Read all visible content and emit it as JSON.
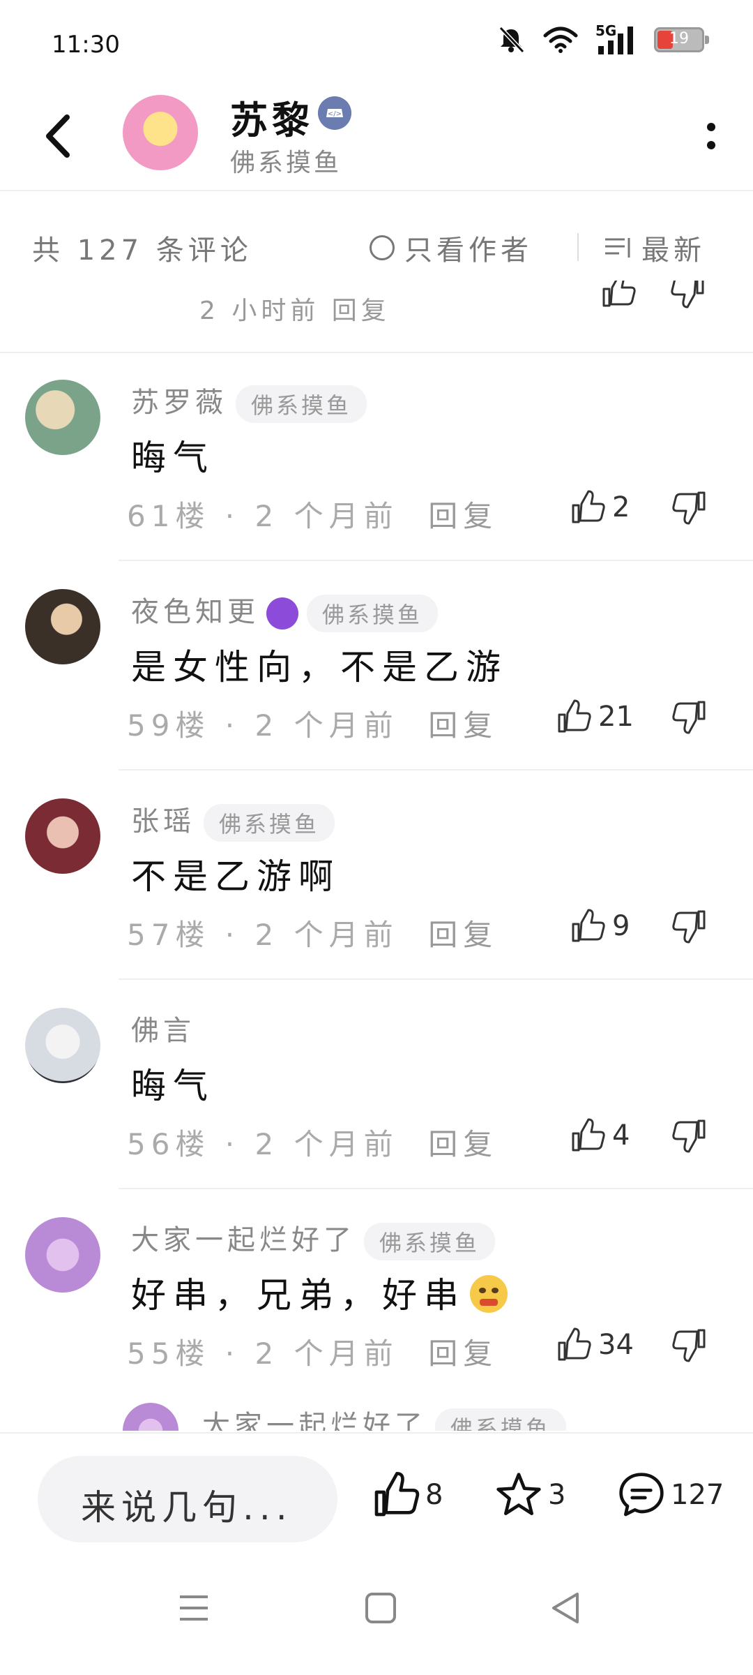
{
  "status_bar": {
    "time": "11:30",
    "network": "5G",
    "battery": "19"
  },
  "header": {
    "name": "苏黎",
    "subtitle": "佛系摸鱼"
  },
  "filter": {
    "count_text": "共 127 条评论",
    "author_only_label": "只看作者",
    "sort_label": "最新"
  },
  "partial_prev": {
    "meta": "2 小时前 回复"
  },
  "comments": [
    {
      "username": "苏罗薇",
      "tag": "佛系摸鱼",
      "content": "晦气",
      "floor": "61楼",
      "time": "2 个月前",
      "reply": "回复",
      "likes": "2",
      "avatar_color": "#7aa38a"
    },
    {
      "username": "夜色知更",
      "tag": "佛系摸鱼",
      "content": "是女性向，不是乙游",
      "floor": "59楼",
      "time": "2 个月前",
      "reply": "回复",
      "likes": "21",
      "avatar_color": "#3a3028"
    },
    {
      "username": "张瑶",
      "tag": "佛系摸鱼",
      "content": "不是乙游啊",
      "floor": "57楼",
      "time": "2 个月前",
      "reply": "回复",
      "likes": "9",
      "avatar_color": "#7a2b33"
    },
    {
      "username": "佛言",
      "content": "晦气",
      "floor": "56楼",
      "time": "2 个月前",
      "reply": "回复",
      "likes": "4",
      "avatar_color": "#d7dbe2"
    },
    {
      "username": "大家一起烂好了",
      "tag": "佛系摸鱼",
      "content": "好串，兄弟，好串",
      "floor": "55楼",
      "time": "2 个月前",
      "reply": "回复",
      "likes": "34",
      "avatar_color": "#b98ad6"
    }
  ],
  "partial_next": {
    "username": "大家一起烂好了",
    "tag": "佛系摸鱼"
  },
  "bottom_bar": {
    "input_placeholder": "来说几句...",
    "likes": "8",
    "favorites": "3",
    "comments": "127"
  },
  "colors": {
    "badge": "#8c4bd8",
    "battery_low": "#e6443b"
  }
}
